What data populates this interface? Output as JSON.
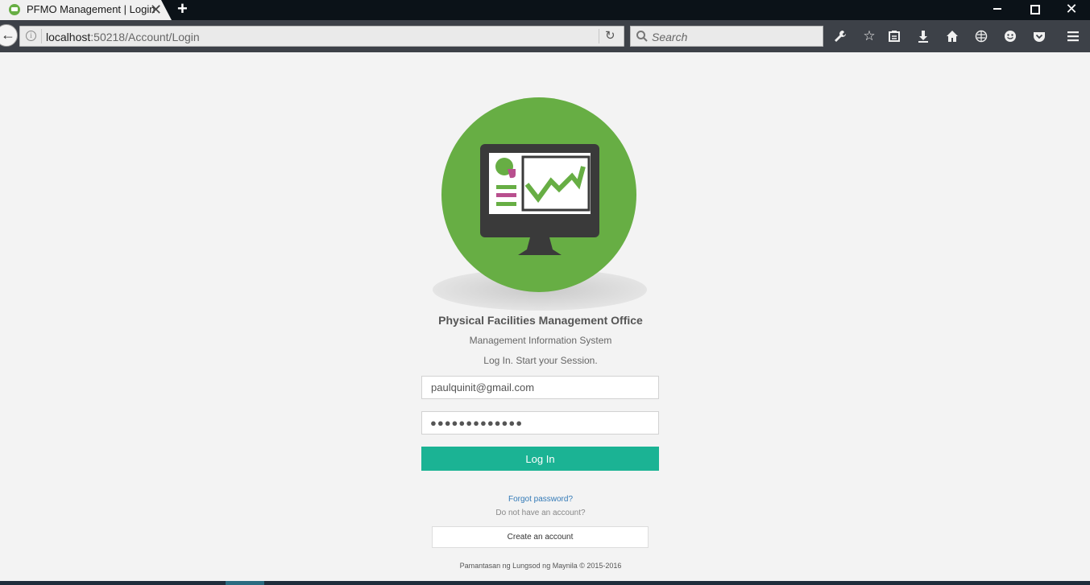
{
  "browser": {
    "tab_title": "PFMO Management | Login",
    "tab_close": "✕",
    "new_tab": "+",
    "url_host": "localhost",
    "url_path": ":50218/Account/Login",
    "search_placeholder": "Search"
  },
  "page": {
    "org_title": "Physical Facilities Management Office",
    "subtitle": "Management Information System",
    "session_text": "Log In. Start your Session.",
    "email_value": "paulquinit@gmail.com",
    "password_mask": "●●●●●●●●●●●●●",
    "login_label": "Log In",
    "forgot_label": "Forgot password?",
    "no_account_text": "Do not have an account?",
    "create_account_label": "Create an account",
    "footer": "Pamantasan ng Lungsod ng Maynila © 2015-2016"
  },
  "colors": {
    "brand_green": "#67ae44",
    "button_teal": "#1bb394",
    "link_blue": "#337ab7",
    "monitor_dark": "#3a3a3a",
    "chart_magenta": "#b84f8e"
  }
}
